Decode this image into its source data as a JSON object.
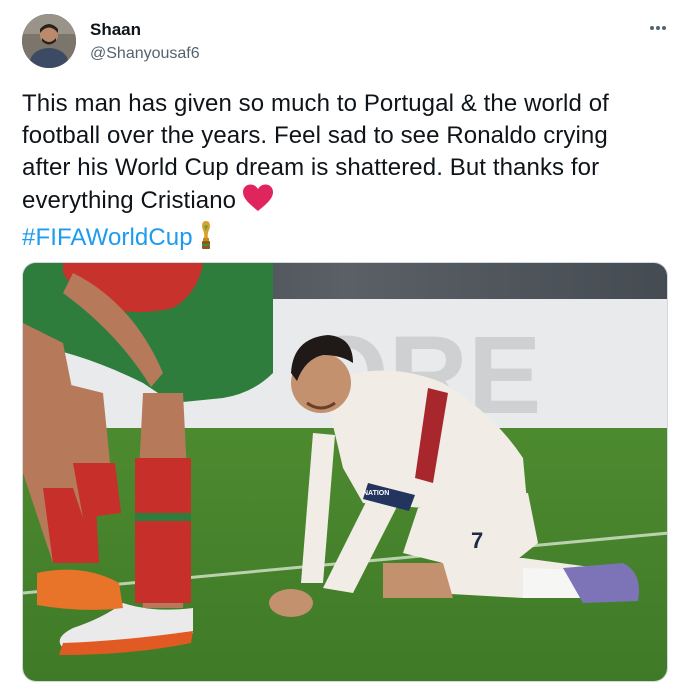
{
  "author": {
    "display_name": "Shaan",
    "handle": "@Shanyousaf6",
    "avatar_icon": "user-avatar"
  },
  "more_icon": "more-horizontal-icon",
  "tweet": {
    "lines": [
      "This man has given so much to Portugal & the world of",
      "football over the years. Feel sad to see Ronaldo crying",
      "after his World Cup dream is shattered. But thanks for",
      "everything Cristiano"
    ],
    "hashtag": "#FIFAWorldCup",
    "emoji": [
      "red-heart-emoji",
      "trophy-emoji"
    ]
  },
  "media": {
    "kind": "photo",
    "jersey_number": "7",
    "sleeve_patch_text": "NATION"
  },
  "colors": {
    "hashtag": "#1d9bf0",
    "secondary_text": "#536471",
    "heart": "#e0245e"
  }
}
